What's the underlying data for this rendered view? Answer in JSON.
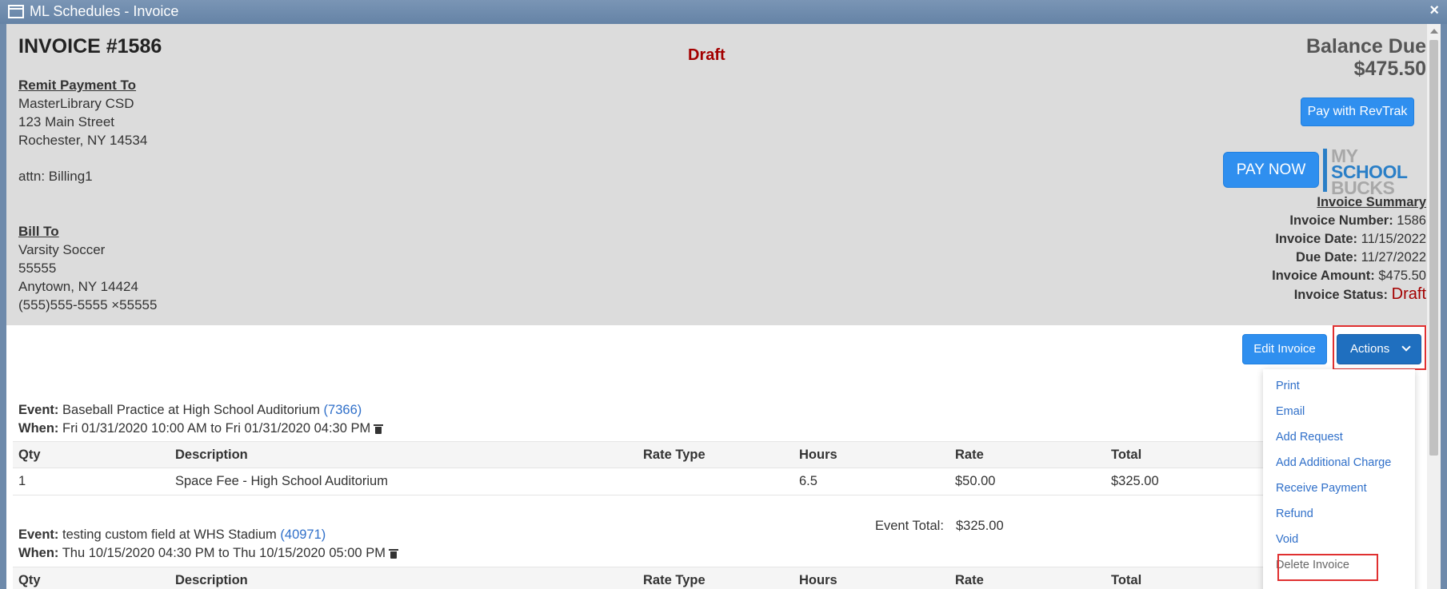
{
  "window": {
    "title": "ML Schedules - Invoice",
    "close_glyph": "×"
  },
  "invoice": {
    "title": "INVOICE #1586",
    "status_center": "Draft",
    "balance_label": "Balance Due",
    "balance_amount": "$475.50"
  },
  "remit": {
    "heading": "Remit Payment To",
    "name": "MasterLibrary CSD",
    "street": "123 Main Street",
    "city": "Rochester, NY 14534",
    "attn": "attn:  Billing1"
  },
  "bill_to": {
    "heading": "Bill To",
    "name": "Varsity Soccer",
    "line2": "55555",
    "city": "Anytown, NY 14424",
    "phone": "(555)555-5555 ×55555"
  },
  "payment": {
    "revtrak_label": "Pay with RevTrak",
    "paynow_label": "PAY NOW",
    "logo_lines": [
      "MY",
      "SCHOOL",
      "BUCKS"
    ]
  },
  "summary": {
    "heading": "Invoice Summary",
    "number_label": "Invoice Number:",
    "number": "1586",
    "date_label": "Invoice Date:",
    "date": "11/15/2022",
    "due_label": "Due Date:",
    "due": "11/27/2022",
    "amount_label": "Invoice Amount:",
    "amount": "$475.50",
    "status_label": "Invoice Status:",
    "status": "Draft"
  },
  "toolbar": {
    "edit_label": "Edit Invoice",
    "actions_label": "Actions"
  },
  "actions_menu": [
    "Print",
    "Email",
    "Add Request",
    "Add Additional Charge",
    "Receive Payment",
    "Refund",
    "Void",
    "Delete Invoice"
  ],
  "columns": [
    "Qty",
    "Description",
    "Rate Type",
    "Hours",
    "Rate",
    "Total"
  ],
  "events": [
    {
      "event_label": "Event:",
      "event_name": "Baseball Practice at High School Auditorium",
      "event_id": "(7366)",
      "when_label": "When:",
      "when": "Fri 01/31/2020 10:00 AM to Fri 01/31/2020 04:30 PM",
      "rows": [
        {
          "qty": "1",
          "description": "Space Fee - High School Auditorium",
          "rate_type": "",
          "hours": "6.5",
          "rate": "$50.00",
          "total": "$325.00"
        }
      ],
      "total_label": "Event Total:",
      "total": "$325.00"
    },
    {
      "event_label": "Event:",
      "event_name": "testing custom field at WHS Stadium",
      "event_id": "(40971)",
      "when_label": "When:",
      "when": "Thu 10/15/2020 04:30 PM to Thu 10/15/2020 05:00 PM"
    }
  ],
  "colors": {
    "accent": "#2f8fef",
    "draft": "#a40000",
    "link": "#2f6fc9",
    "highlight": "#e03030"
  }
}
